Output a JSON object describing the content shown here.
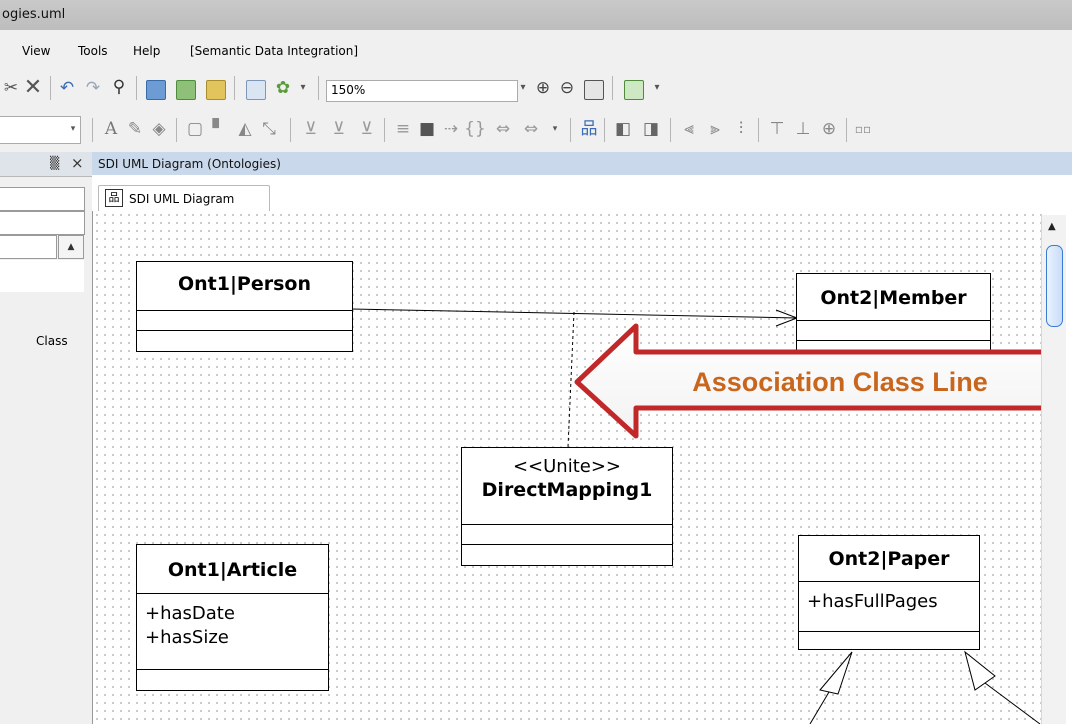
{
  "window": {
    "title": "ogies.uml"
  },
  "menu": {
    "items": [
      "View",
      "Tools",
      "Help",
      "[Semantic Data Integration]"
    ]
  },
  "toolbar": {
    "zoom_value": "150%"
  },
  "left_panel": {
    "pin_glyph": "▒",
    "close_glyph": "×",
    "class_label": "Class"
  },
  "document": {
    "header_title": "SDI UML Diagram (Ontologies)",
    "tab_label": "SDI UML Diagram"
  },
  "diagram": {
    "classes": [
      {
        "name": "Ont1|Person",
        "attributes": []
      },
      {
        "name": "Ont2|Member",
        "attributes": []
      },
      {
        "stereotype": "<<Unite>>",
        "name": "DirectMapping1",
        "attributes": []
      },
      {
        "name": "Ont1|Article",
        "attributes": [
          "+hasDate",
          "+hasSize"
        ]
      },
      {
        "name": "Ont2|Paper",
        "attributes": [
          "+hasFullPages"
        ]
      }
    ],
    "callout_text": "Association Class Line"
  },
  "colors": {
    "callout_text": "#c8661e",
    "callout_border": "#c0282a",
    "doc_header": "#c9d8ea",
    "scroll_thumb": "#3a7bd5"
  }
}
